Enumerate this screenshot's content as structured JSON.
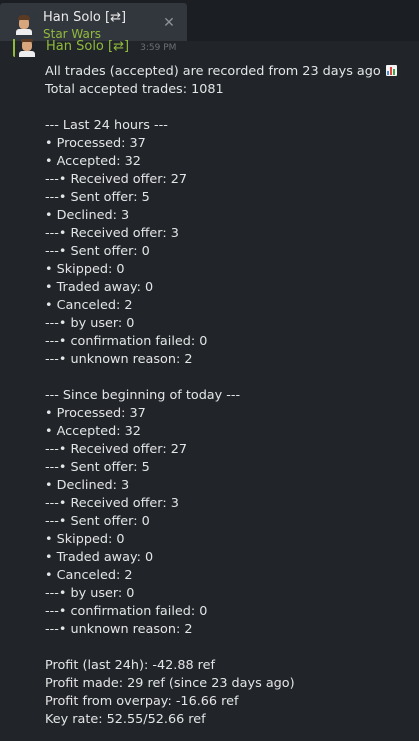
{
  "tab": {
    "name": "Han Solo [⇄]",
    "game": "Star Wars",
    "close_glyph": "✕",
    "icons": {
      "avatar": "user-avatar",
      "close": "close-icon"
    }
  },
  "message": {
    "author": "Han Solo [⇄]",
    "time": "3:59 PM",
    "lines": [
      "All trades (accepted) are recorded from 23 days ago",
      "Total accepted trades: 1081",
      "",
      "--- Last 24 hours ---",
      "• Processed: 37",
      "• Accepted: 32",
      "---• Received offer: 27",
      "---• Sent offer: 5",
      "• Declined: 3",
      "---• Received offer: 3",
      "---• Sent offer: 0",
      "• Skipped: 0",
      "• Traded away: 0",
      "• Canceled: 2",
      "---• by user: 0",
      "---• confirmation failed: 0",
      "---• unknown reason: 2",
      "",
      "--- Since beginning of today ---",
      "• Processed: 37",
      "• Accepted: 32",
      "---• Received offer: 27",
      "---• Sent offer: 5",
      "• Declined: 3",
      "---• Received offer: 3",
      "---• Sent offer: 0",
      "• Skipped: 0",
      "• Traded away: 0",
      "• Canceled: 2",
      "---• by user: 0",
      "---• confirmation failed: 0",
      "---• unknown reason: 2",
      "",
      "Profit (last 24h): -42.88 ref",
      "Profit made: 29 ref (since 23 days ago)",
      "Profit from overpay: -16.66 ref",
      "Key rate: 52.55/52.66 ref"
    ],
    "emoji_icon": "bar-chart-emoji-icon"
  },
  "colors": {
    "background": "#212529",
    "tab_active": "#32363d",
    "in_game_green": "#90ba3c",
    "text": "#dcdedf",
    "muted": "#6b7079"
  }
}
